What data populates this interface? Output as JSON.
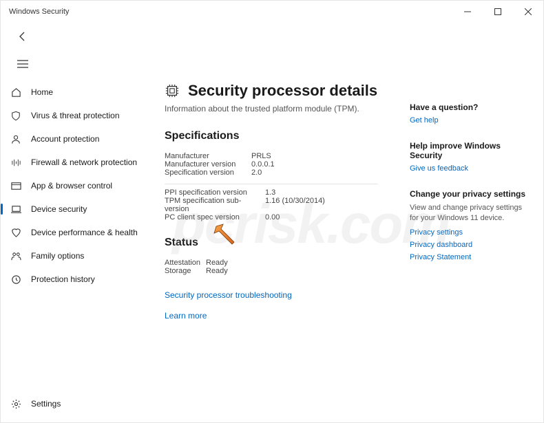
{
  "titlebar": {
    "title": "Windows Security"
  },
  "sidebar": {
    "items": [
      {
        "label": "Home"
      },
      {
        "label": "Virus & threat protection"
      },
      {
        "label": "Account protection"
      },
      {
        "label": "Firewall & network protection"
      },
      {
        "label": "App & browser control"
      },
      {
        "label": "Device security"
      },
      {
        "label": "Device performance & health"
      },
      {
        "label": "Family options"
      },
      {
        "label": "Protection history"
      }
    ],
    "footer": {
      "label": "Settings"
    }
  },
  "page": {
    "title": "Security processor details",
    "subtitle": "Information about the trusted platform module (TPM)."
  },
  "specs": {
    "heading": "Specifications",
    "group1": [
      {
        "label": "Manufacturer",
        "value": "PRLS"
      },
      {
        "label": "Manufacturer version",
        "value": "0.0.0.1"
      },
      {
        "label": "Specification version",
        "value": "2.0"
      }
    ],
    "group2": [
      {
        "label": "PPI specification version",
        "value": "1.3"
      },
      {
        "label": "TPM specification sub-version",
        "value": "1.16 (10/30/2014)"
      },
      {
        "label": "PC client spec version",
        "value": "0.00"
      }
    ]
  },
  "status": {
    "heading": "Status",
    "rows": [
      {
        "label": "Attestation",
        "value": "Ready"
      },
      {
        "label": "Storage",
        "value": "Ready"
      }
    ],
    "troubleshoot_link": "Security processor troubleshooting",
    "learn_more": "Learn more"
  },
  "right": {
    "question": {
      "title": "Have a question?",
      "link": "Get help"
    },
    "improve": {
      "title": "Help improve Windows Security",
      "link": "Give us feedback"
    },
    "privacy": {
      "title": "Change your privacy settings",
      "text": "View and change privacy settings for your Windows 11 device.",
      "links": [
        "Privacy settings",
        "Privacy dashboard",
        "Privacy Statement"
      ]
    }
  },
  "watermark": "pcrisk.com"
}
